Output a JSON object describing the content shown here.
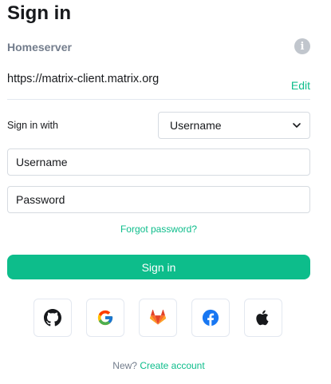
{
  "title": "Sign in",
  "homeserver": {
    "label": "Homeserver",
    "url": "https://matrix-client.matrix.org",
    "edit_label": "Edit"
  },
  "signin_with": {
    "label": "Sign in with",
    "selected": "Username"
  },
  "fields": {
    "username_placeholder": "Username",
    "password_placeholder": "Password"
  },
  "forgot_password": "Forgot password?",
  "signin_button": "Sign in",
  "sso_providers": [
    "github-icon",
    "google-icon",
    "gitlab-icon",
    "facebook-icon",
    "apple-icon"
  ],
  "footer": {
    "prefix": "New?",
    "link": "Create account"
  },
  "colors": {
    "accent": "#0dbd8b",
    "muted": "#737d8c",
    "border": "#d6dbe1"
  }
}
